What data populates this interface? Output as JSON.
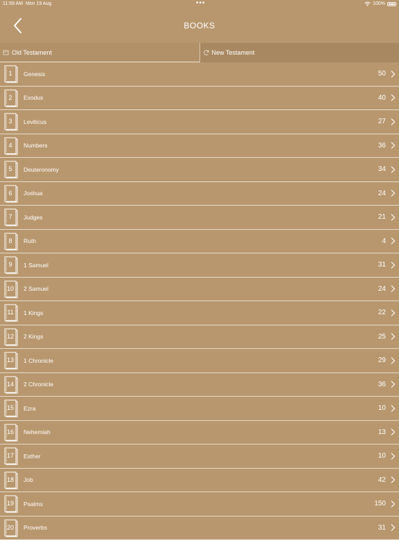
{
  "status": {
    "time": "11:59 AM",
    "date": "Mon 19 Aug",
    "battery": "100%"
  },
  "header": {
    "title": "BOOKS"
  },
  "tabs": [
    {
      "label": "Old Testament",
      "icon": "book-scroll-icon",
      "active": true
    },
    {
      "label": "New Testament",
      "icon": "refresh-icon",
      "active": false
    }
  ],
  "books": [
    {
      "num": "1",
      "name": "Genesis",
      "chapters": "50"
    },
    {
      "num": "2",
      "name": "Exodus",
      "chapters": "40"
    },
    {
      "num": "3",
      "name": "Leviticus",
      "chapters": "27"
    },
    {
      "num": "4",
      "name": "Numbers",
      "chapters": "36"
    },
    {
      "num": "5",
      "name": "Deuteronomy",
      "chapters": "34"
    },
    {
      "num": "6",
      "name": "Joshua",
      "chapters": "24"
    },
    {
      "num": "7",
      "name": "Judges",
      "chapters": "21"
    },
    {
      "num": "8",
      "name": "Ruth",
      "chapters": "4"
    },
    {
      "num": "9",
      "name": "1 Samuel",
      "chapters": "31"
    },
    {
      "num": "10",
      "name": "2 Samuel",
      "chapters": "24"
    },
    {
      "num": "11",
      "name": "1 Kings",
      "chapters": "22"
    },
    {
      "num": "12",
      "name": "2 Kings",
      "chapters": "25"
    },
    {
      "num": "13",
      "name": "1 Chronicle",
      "chapters": "29"
    },
    {
      "num": "14",
      "name": "2 Chronicle",
      "chapters": "36"
    },
    {
      "num": "15",
      "name": "Ezra",
      "chapters": "10"
    },
    {
      "num": "16",
      "name": "Nehemiah",
      "chapters": "13"
    },
    {
      "num": "17",
      "name": "Esther",
      "chapters": "10"
    },
    {
      "num": "18",
      "name": "Job",
      "chapters": "42"
    },
    {
      "num": "19",
      "name": "Psalms",
      "chapters": "150"
    },
    {
      "num": "20",
      "name": "Proverbs",
      "chapters": "31"
    }
  ]
}
